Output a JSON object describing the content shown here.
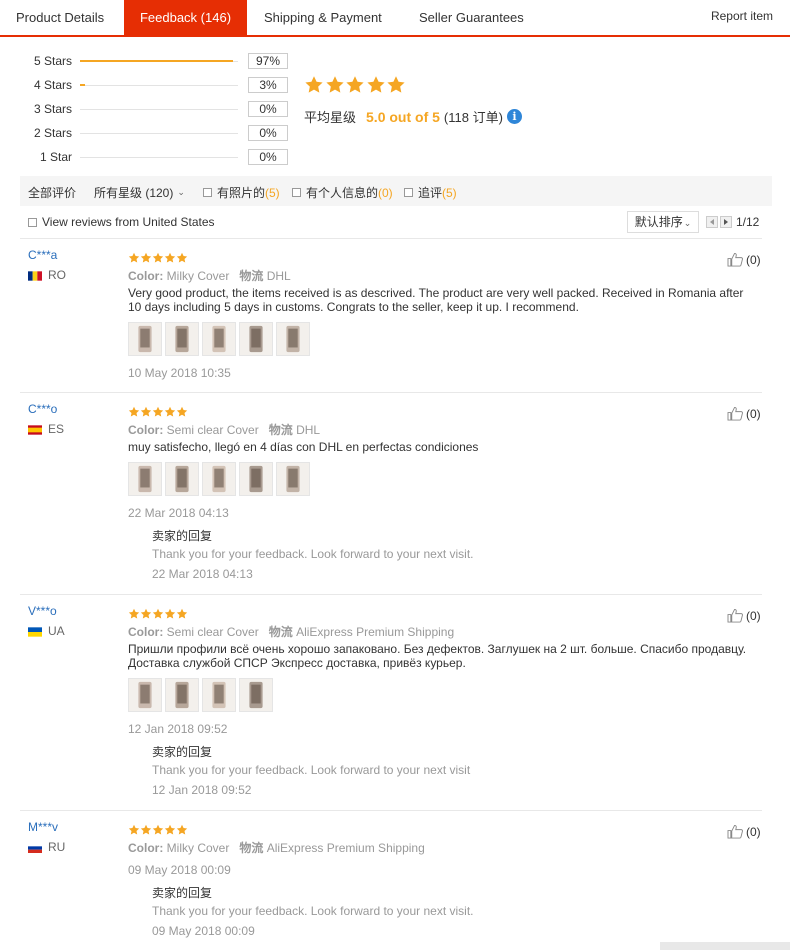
{
  "tabs": [
    {
      "label": "Product Details",
      "active": false
    },
    {
      "label": "Feedback (146)",
      "active": true
    },
    {
      "label": "Shipping & Payment",
      "active": false
    },
    {
      "label": "Seller Guarantees",
      "active": false
    }
  ],
  "report_link": "Report item",
  "histogram": [
    {
      "label": "5 Stars",
      "pct_text": "97%",
      "fraction": 0.97
    },
    {
      "label": "4 Stars",
      "pct_text": "3%",
      "fraction": 0.03
    },
    {
      "label": "3 Stars",
      "pct_text": "0%",
      "fraction": 0
    },
    {
      "label": "2 Stars",
      "pct_text": "0%",
      "fraction": 0
    },
    {
      "label": "1 Star",
      "pct_text": "0%",
      "fraction": 0
    }
  ],
  "summary": {
    "stars": 5,
    "label": "平均星级",
    "score": "5.0 out of 5",
    "count": "(118 订单)",
    "info_icon": "info-icon"
  },
  "filters": {
    "all": "全部评价",
    "stars_select": "所有星级 (120)",
    "with_photos": "有照片的",
    "with_photos_count": "(5)",
    "personal_info": "有个人信息的",
    "personal_info_count": "(0)",
    "followup": "追评",
    "followup_count": "(5)"
  },
  "us_filter": "View reviews from United States",
  "sort_label": "默认排序",
  "pager": "1/12",
  "attr_labels": {
    "color": "Color:",
    "logistics": "物流"
  },
  "reviews": [
    {
      "user": "C***a",
      "country": "RO",
      "flag": "flag-ro",
      "stars": 5,
      "color": "Milky Cover",
      "logistics": "DHL",
      "text": "Very good product, the items received is as descrived. The product are very well packed. Received in Romania after 10 days including 5 days in customs. Congrats to the seller, keep it up. I recommend.",
      "photo_count": 5,
      "date": "10 May 2018 10:35",
      "helpful": "(0)"
    },
    {
      "user": "C***o",
      "country": "ES",
      "flag": "flag-es",
      "stars": 5,
      "color": "Semi clear Cover",
      "logistics": "DHL",
      "text": "muy satisfecho, llegó en 4 días con DHL en perfectas condiciones",
      "photo_count": 5,
      "date": "22 Mar 2018 04:13",
      "reply_title": "卖家的回复",
      "reply_text": "Thank you for your feedback. Look forward to your next visit.",
      "reply_date": "22 Mar 2018 04:13",
      "helpful": "(0)"
    },
    {
      "user": "V***o",
      "country": "UA",
      "flag": "flag-ua",
      "stars": 5,
      "color": "Semi clear Cover",
      "logistics": "AliExpress Premium Shipping",
      "text": "Пришли профили всё очень хорошо запаковано. Без дефектов. Заглушек на 2 шт. больше. Спасибо продавцу. Доставка службой СПСР Экспресс доставка, привёз курьер.",
      "photo_count": 4,
      "date": "12 Jan 2018 09:52",
      "reply_title": "卖家的回复",
      "reply_text": "Thank you for your feedback. Look forward to your next visit",
      "reply_date": "12 Jan 2018 09:52",
      "helpful": "(0)"
    },
    {
      "user": "M***v",
      "country": "RU",
      "flag": "flag-ru",
      "stars": 5,
      "color": "Milky Cover",
      "logistics": "AliExpress Premium Shipping",
      "date": "09 May 2018 00:09",
      "reply_title": "卖家的回复",
      "reply_text": "Thank you for your feedback. Look forward to your next visit.",
      "reply_date": "09 May 2018 00:09",
      "helpful": "(0)"
    }
  ],
  "colors": {
    "accent": "#e62e04",
    "star": "#f5a623",
    "link": "#2a6ebb",
    "info": "#2f86d8"
  }
}
